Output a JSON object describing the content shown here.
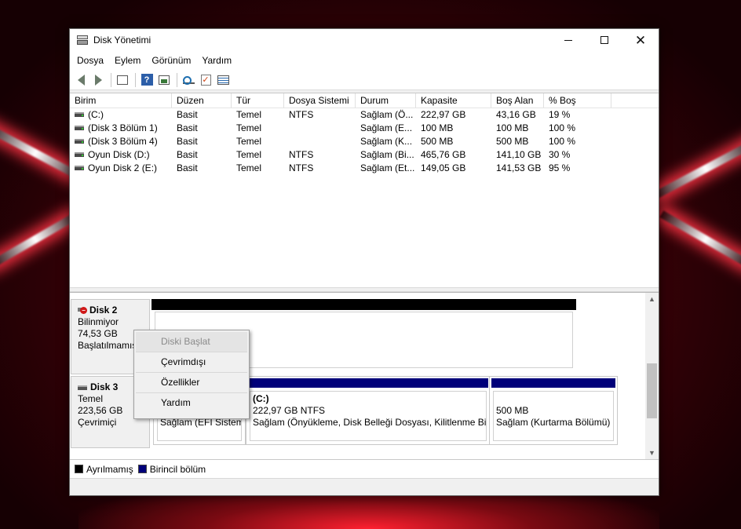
{
  "window": {
    "title": "Disk Yönetimi"
  },
  "menu": [
    "Dosya",
    "Eylem",
    "Görünüm",
    "Yardım"
  ],
  "toolbar": [
    "back-icon",
    "forward-icon",
    "console-tree-icon",
    "help-icon",
    "show-pane-icon",
    "rescan-icon",
    "check-icon",
    "properties-icon"
  ],
  "volume_table": {
    "columns": [
      "Birim",
      "Düzen",
      "Tür",
      "Dosya Sistemi",
      "Durum",
      "Kapasite",
      "Boş Alan",
      "% Boş"
    ],
    "rows": [
      [
        "(C:)",
        "Basit",
        "Temel",
        "NTFS",
        "Sağlam (Ö...",
        "222,97 GB",
        "43,16 GB",
        "19 %"
      ],
      [
        "(Disk 3 Bölüm 1)",
        "Basit",
        "Temel",
        "",
        "Sağlam (E...",
        "100 MB",
        "100 MB",
        "100 %"
      ],
      [
        "(Disk 3 Bölüm 4)",
        "Basit",
        "Temel",
        "",
        "Sağlam (K...",
        "500 MB",
        "500 MB",
        "100 %"
      ],
      [
        "Oyun Disk (D:)",
        "Basit",
        "Temel",
        "NTFS",
        "Sağlam (Bi...",
        "465,76 GB",
        "141,10 GB",
        "30 %"
      ],
      [
        "Oyun Disk 2 (E:)",
        "Basit",
        "Temel",
        "NTFS",
        "Sağlam (Et...",
        "149,05 GB",
        "141,53 GB",
        "95 %"
      ]
    ]
  },
  "disks": [
    {
      "name": "Disk 2",
      "line1": "Bilinmiyor",
      "line2": "74,53 GB",
      "line3": "Başlatılmamış"
    },
    {
      "name": "Disk 3",
      "line1": "Temel",
      "line2": "223,56 GB",
      "line3": "Çevrimiçi",
      "partitions": [
        {
          "status": "Sağlam (EFI Sistem"
        },
        {
          "title": "(C:)",
          "size": "222,97 GB NTFS",
          "status": "Sağlam (Önyükleme, Disk Belleği Dosyası, Kilitlenme Bilg"
        },
        {
          "size": "500 MB",
          "status": "Sağlam (Kurtarma Bölümü)"
        }
      ]
    }
  ],
  "legend": {
    "unallocated": "Ayrılmamış",
    "primary": "Birincil bölüm"
  },
  "context_menu": [
    "Diski Başlat",
    "Çevrimdışı",
    "Özellikler",
    "Yardım"
  ],
  "colors": {
    "unallocated": "#000000",
    "primary": "#00007a"
  }
}
